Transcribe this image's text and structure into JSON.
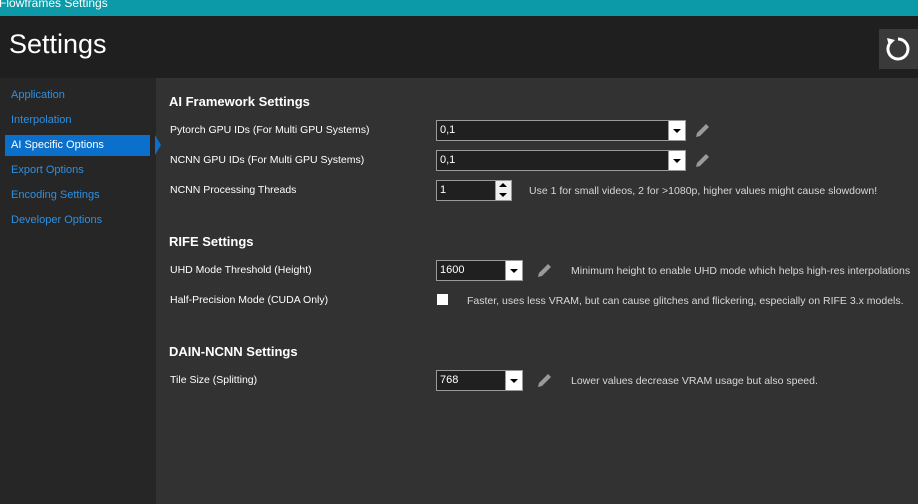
{
  "window": {
    "title": "Flowframes Settings"
  },
  "header": {
    "title": "Settings",
    "refresh_icon": "refresh-icon"
  },
  "sidebar": {
    "items": [
      {
        "label": "Application"
      },
      {
        "label": "Interpolation"
      },
      {
        "label": "AI Specific Options",
        "active": true
      },
      {
        "label": "Export Options"
      },
      {
        "label": "Encoding Settings"
      },
      {
        "label": "Developer Options"
      }
    ]
  },
  "ai_framework": {
    "title": "AI Framework Settings",
    "pytorch_gpu": {
      "label": "Pytorch GPU IDs (For Multi GPU Systems)",
      "value": "0,1"
    },
    "ncnn_gpu": {
      "label": "NCNN GPU IDs (For Multi GPU Systems)",
      "value": "0,1"
    },
    "ncnn_threads": {
      "label": "NCNN Processing Threads",
      "value": "1",
      "hint": "Use 1 for small videos, 2 for >1080p, higher values might cause slowdown!"
    }
  },
  "rife": {
    "title": "RIFE Settings",
    "uhd_threshold": {
      "label": "UHD Mode Threshold (Height)",
      "value": "1600",
      "hint": "Minimum height to enable UHD mode which helps high-res interpolations"
    },
    "half_precision": {
      "label": "Half-Precision Mode (CUDA Only)",
      "checked": false,
      "hint": "Faster, uses less VRAM, but can cause glitches and flickering, especially on RIFE 3.x models."
    }
  },
  "dain": {
    "title": "DAIN-NCNN Settings",
    "tile_size": {
      "label": "Tile Size (Splitting)",
      "value": "768",
      "hint": "Lower values decrease VRAM usage but also speed."
    }
  },
  "colors": {
    "accent": "#0b6fcc",
    "link": "#2d90e3",
    "titlebar": "#0c9aa8"
  }
}
